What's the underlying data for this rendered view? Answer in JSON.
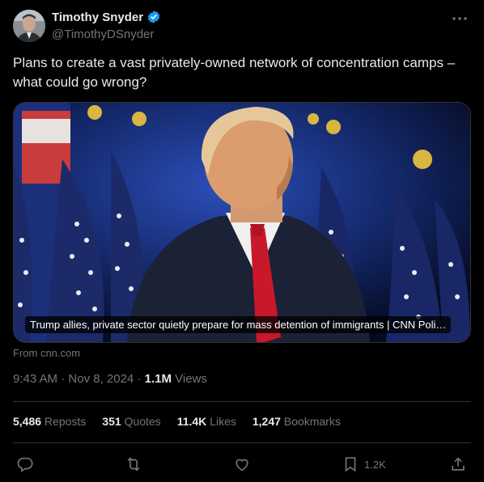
{
  "author": {
    "name": "Timothy Snyder",
    "handle": "@TimothyDSnyder",
    "verified_color": "#1d9bf0"
  },
  "tweet": {
    "text": "Plans to create a vast privately-owned network of concentration camps – what could go wrong?"
  },
  "card": {
    "caption": "Trump allies, private sector quietly prepare for mass detention of immigrants | CNN Poli…",
    "from": "From cnn.com"
  },
  "meta": {
    "time": "9:43 AM",
    "sep": " · ",
    "date": "Nov 8, 2024",
    "sep2": " · ",
    "views_count": "1.1M",
    "views_label": " Views"
  },
  "stats": {
    "reposts": {
      "num": "5,486",
      "label": " Reposts"
    },
    "quotes": {
      "num": "351",
      "label": " Quotes"
    },
    "likes": {
      "num": "11.4K",
      "label": " Likes"
    },
    "bookmarks": {
      "num": "1,247",
      "label": " Bookmarks"
    }
  },
  "actions": {
    "bookmark_count": "1.2K"
  },
  "icons": [
    "more-icon",
    "verified-icon",
    "reply-icon",
    "repost-icon",
    "like-icon",
    "bookmark-icon",
    "share-icon"
  ]
}
